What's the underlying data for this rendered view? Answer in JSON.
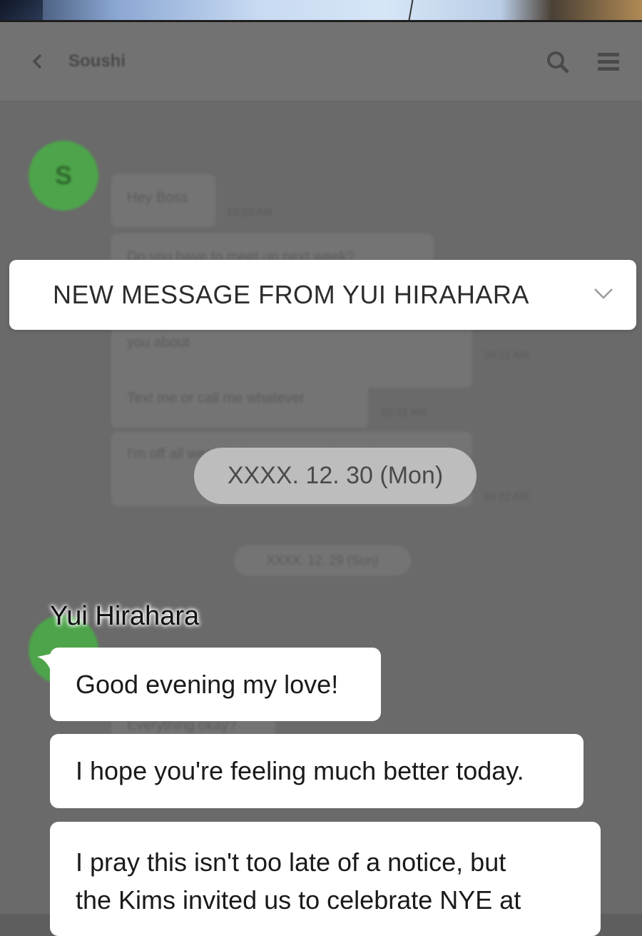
{
  "header": {
    "contact_name": "Soushi"
  },
  "background_chat": {
    "avatar_initial": "S",
    "messages": [
      {
        "text": "Hey Boss",
        "time": "10:20 AM"
      },
      {
        "text": "Do you have to meet up next week?",
        "time": ""
      },
      {
        "text": "you about",
        "time": "10:21 AM"
      },
      {
        "text": "Text me or call me whatever",
        "time": "10:21 AM"
      },
      {
        "text": "I'm off all week right now so I'm free whenever",
        "time": "10:22 AM"
      }
    ],
    "date_chip": "XXXX. 12. 29 (Sun)",
    "partial_message": "Everything okay?"
  },
  "notification": {
    "text": "NEW MESSAGE FROM YUI HIRAHARA",
    "icon": "chevron-down-icon"
  },
  "date_pill": "XXXX. 12. 30 (Mon)",
  "incoming": {
    "sender": "Yui Hirahara",
    "messages": [
      "Good evening my love!",
      "I hope you're feeling much better today.",
      "I pray this isn't too late of a notice, but",
      "the Kims invited us to celebrate NYE at"
    ]
  },
  "colors": {
    "avatar_green": "#4da44a",
    "overlay": "#6a6a6a",
    "bubble": "#ffffff"
  }
}
